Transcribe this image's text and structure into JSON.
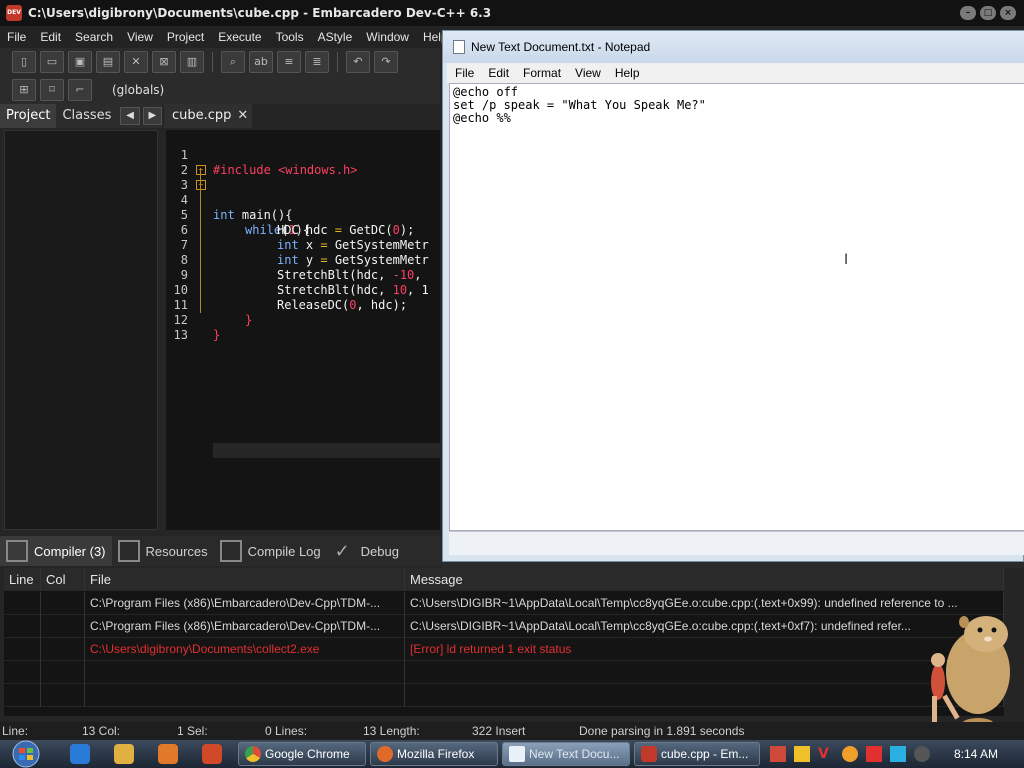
{
  "devcpp": {
    "title": "C:\\Users\\digibrony\\Documents\\cube.cpp - Embarcadero Dev-C++ 6.3",
    "menu": [
      "File",
      "Edit",
      "Search",
      "View",
      "Project",
      "Execute",
      "Tools",
      "AStyle",
      "Window",
      "Help"
    ],
    "scope": "(globals)",
    "left_tabs": [
      "Project",
      "Classes"
    ],
    "editor_tab": "cube.cpp",
    "line_numbers": [
      "1",
      "2",
      "3",
      "4",
      "5",
      "6",
      "7",
      "8",
      "9",
      "10",
      "11",
      "12",
      "13"
    ],
    "code": {
      "l1": "#include <windows.h>",
      "l3a": "int",
      "l3b": " main(){",
      "l4a": "while",
      "l4b": "(",
      "l4c": "1",
      "l4d": "){",
      "l5a": "HDC hdc ",
      "l5b": "=",
      "l5c": " GetDC(",
      "l5d": "0",
      "l5e": ");",
      "l6a": "int",
      "l6b": " x ",
      "l6c": "=",
      "l6d": " GetSystemMetr",
      "l7a": "int",
      "l7b": " y ",
      "l7c": "=",
      "l7d": " GetSystemMetr",
      "l8a": "StretchBlt(hdc, ",
      "l8b": "-10",
      "l8c": ",",
      "l9a": "StretchBlt(hdc, ",
      "l9b": "10",
      "l9c": ", 1",
      "l10a": "ReleaseDC(",
      "l10b": "0",
      "l10c": ", hdc);",
      "l11": "}",
      "l12": "}"
    },
    "bottom_tabs": [
      "Compiler (3)",
      "Resources",
      "Compile Log",
      "Debug"
    ],
    "messages": {
      "headers": [
        "Line",
        "Col",
        "File",
        "Message"
      ],
      "rows": [
        {
          "line": "",
          "col": "",
          "file": "C:\\Program Files (x86)\\Embarcadero\\Dev-Cpp\\TDM-...",
          "message": "C:\\Users\\DIGIBR~1\\AppData\\Local\\Temp\\cc8yqGEe.o:cube.cpp:(.text+0x99): undefined reference to ..."
        },
        {
          "line": "",
          "col": "",
          "file": "C:\\Program Files (x86)\\Embarcadero\\Dev-Cpp\\TDM-...",
          "message": "C:\\Users\\DIGIBR~1\\AppData\\Local\\Temp\\cc8yqGEe.o:cube.cpp:(.text+0xf7): undefined refer..."
        },
        {
          "line": "",
          "col": "",
          "file": "C:\\Users\\digibrony\\Documents\\collect2.exe",
          "message": "[Error] ld returned 1 exit status"
        }
      ]
    },
    "status": {
      "line": "Line:",
      "line_val": "13 Col:",
      "sel": "1 Sel:",
      "lines": "0 Lines:",
      "length": "13 Length:",
      "insert": "322 Insert",
      "parse": "Done parsing in 1.891 seconds"
    }
  },
  "notepad": {
    "title": "New Text Document.txt - Notepad",
    "menu": [
      "File",
      "Edit",
      "Format",
      "View",
      "Help"
    ],
    "lines": [
      "@echo off",
      "set /p speak = \"What You Speak Me?\"",
      "@echo %%"
    ]
  },
  "taskbar": {
    "tasks": [
      "Google Chrome",
      "Mozilla Firefox",
      "New Text Docu...",
      "cube.cpp - Em..."
    ],
    "clock": "8:14 AM"
  },
  "colors": {
    "keyword": "#7ab4ff",
    "preprocessor": "#ff3f62",
    "error": "#e03030",
    "notepad_bg": "#ffffff"
  }
}
